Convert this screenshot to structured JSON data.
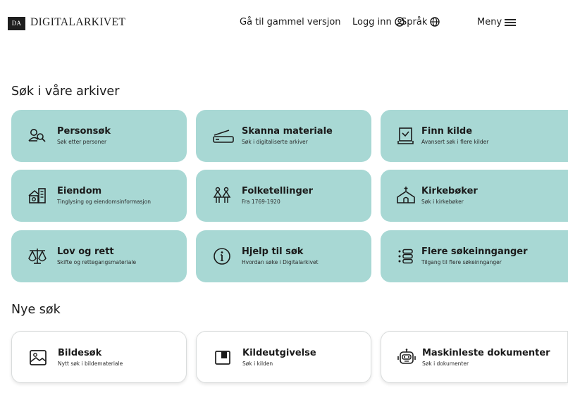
{
  "header": {
    "logo_mark": "DA",
    "logo_text": "DIGITALARKIVET",
    "old_version": "Gå til gammel versjon",
    "login": "Logg inn",
    "language": "Språk",
    "menu": "Meny"
  },
  "archives": {
    "title": "Søk i våre arkiver",
    "cards": [
      {
        "title": "Personsøk",
        "subtitle": "Søk etter personer",
        "icon": "people-search-icon"
      },
      {
        "title": "Skanna materiale",
        "subtitle": "Søk i digitaliserte arkiver",
        "icon": "scanner-icon"
      },
      {
        "title": "Finn kilde",
        "subtitle": "Avansert søk i flere kilder",
        "icon": "source-book-icon"
      },
      {
        "title": "Eiendom",
        "subtitle": "Tinglysing og eiendomsinformasjon",
        "icon": "property-icon"
      },
      {
        "title": "Folketellinger",
        "subtitle": "Fra 1769-1920",
        "icon": "census-people-icon"
      },
      {
        "title": "Kirkebøker",
        "subtitle": "Søk i kirkebøker",
        "icon": "church-icon"
      },
      {
        "title": "Lov og rett",
        "subtitle": "Skifte og rettegangsmateriale",
        "icon": "scales-icon"
      },
      {
        "title": "Hjelp til søk",
        "subtitle": "Hvordan søke i Digitalarkivet",
        "icon": "info-icon"
      },
      {
        "title": "Flere søkeinnganger",
        "subtitle": "Tilgang til flere søkeinnganger",
        "icon": "list-icon"
      }
    ]
  },
  "new_searches": {
    "title": "Nye søk",
    "cards": [
      {
        "title": "Bildesøk",
        "subtitle": "Nytt søk i bildemateriale",
        "icon": "image-icon"
      },
      {
        "title": "Kildeutgivelse",
        "subtitle": "Søk i kilden",
        "icon": "publication-icon"
      },
      {
        "title": "Maskinleste dokumenter",
        "subtitle": "Søk i dokumenter",
        "icon": "robot-icon"
      }
    ]
  },
  "colors": {
    "card_teal": "#a8d8d4",
    "text": "#1b1b1b"
  }
}
